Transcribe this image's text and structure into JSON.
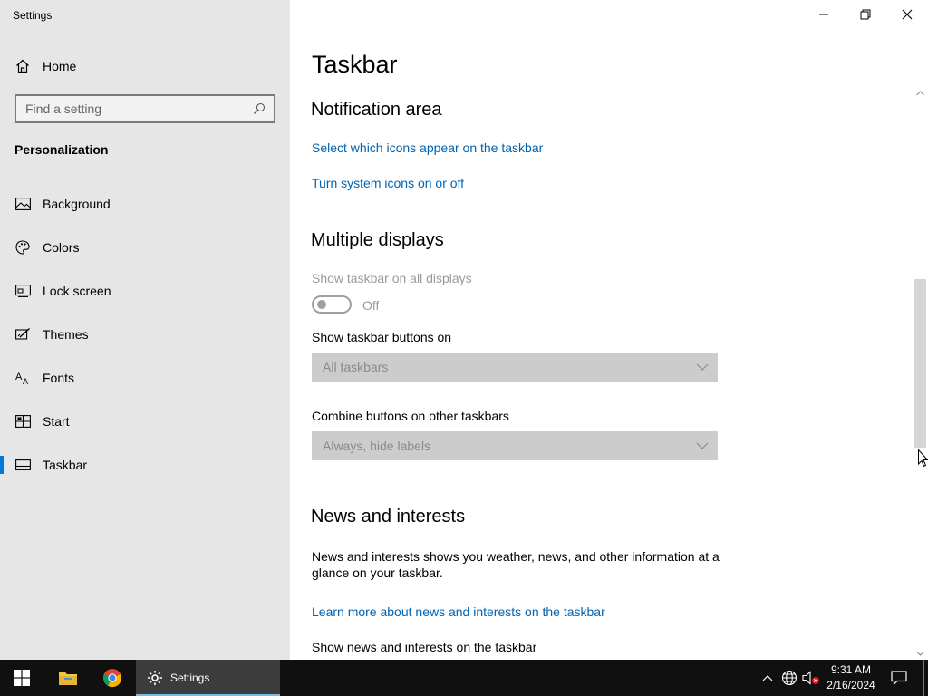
{
  "window": {
    "title": "Settings"
  },
  "sidebar": {
    "home_label": "Home",
    "search_placeholder": "Find a setting",
    "section_title": "Personalization",
    "items": [
      {
        "label": "Background",
        "icon": "picture-icon"
      },
      {
        "label": "Colors",
        "icon": "palette-icon"
      },
      {
        "label": "Lock screen",
        "icon": "lock-screen-icon"
      },
      {
        "label": "Themes",
        "icon": "themes-icon"
      },
      {
        "label": "Fonts",
        "icon": "fonts-icon"
      },
      {
        "label": "Start",
        "icon": "start-icon"
      },
      {
        "label": "Taskbar",
        "icon": "taskbar-icon",
        "active": true
      }
    ]
  },
  "main": {
    "page_title": "Taskbar",
    "notification_area": {
      "heading": "Notification area",
      "link_select_icons": "Select which icons appear on the taskbar",
      "link_system_icons": "Turn system icons on or off"
    },
    "multiple_displays": {
      "heading": "Multiple displays",
      "show_all_label": "Show taskbar on all displays",
      "toggle_state": "Off",
      "buttons_on_label": "Show taskbar buttons on",
      "buttons_on_value": "All taskbars",
      "combine_label": "Combine buttons on other taskbars",
      "combine_value": "Always, hide labels"
    },
    "news": {
      "heading": "News and interests",
      "description": "News and interests shows you weather, news, and other information at a glance on your taskbar.",
      "learn_more_link": "Learn more about news and interests on the taskbar",
      "show_label": "Show news and interests on the taskbar"
    }
  },
  "taskbar": {
    "active_app_label": "Settings",
    "time": "9:31 AM",
    "date": "2/16/2024"
  },
  "colors": {
    "accent": "#0078d7",
    "link": "#0063b1",
    "sidebar_bg": "#e6e6e6",
    "taskbar_bg": "#101010"
  }
}
